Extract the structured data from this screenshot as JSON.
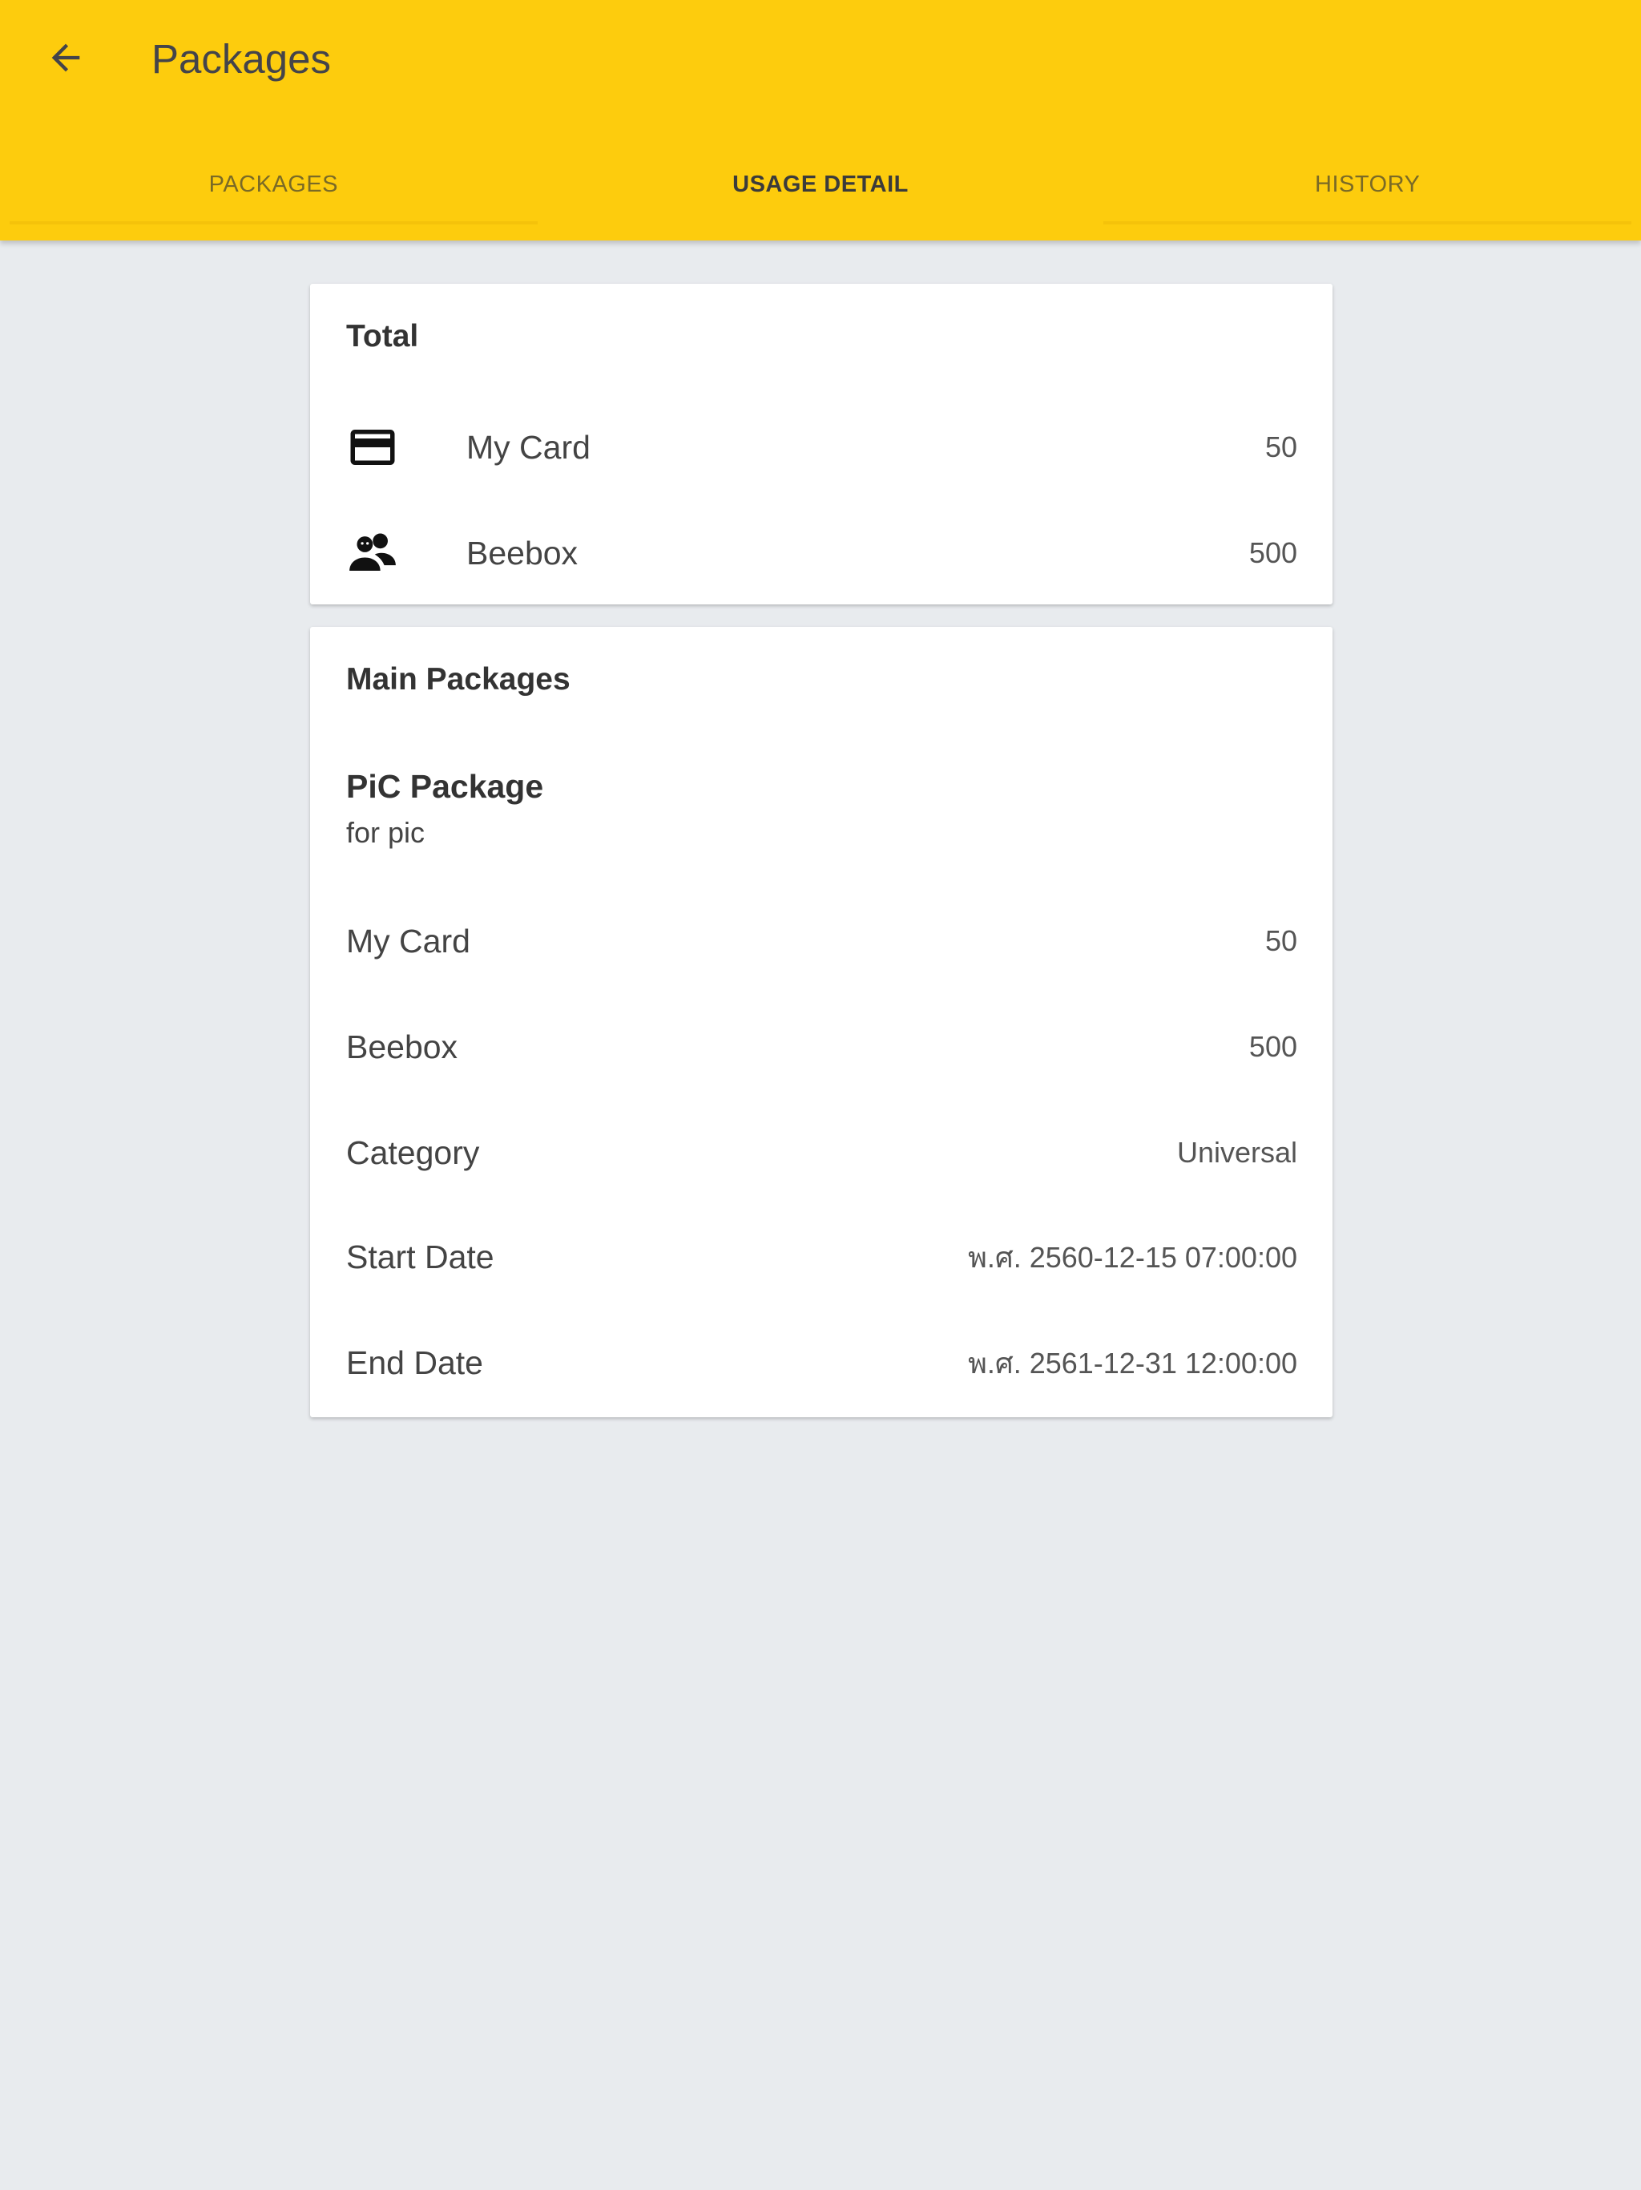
{
  "appbar": {
    "title": "Packages",
    "back_icon": "arrow-back-icon",
    "color": "#fdcc0d"
  },
  "tabs": [
    {
      "label": "PACKAGES",
      "active": false
    },
    {
      "label": "USAGE DETAIL",
      "active": true
    },
    {
      "label": "HISTORY",
      "active": false
    }
  ],
  "total": {
    "title": "Total",
    "items": [
      {
        "icon": "credit-card-icon",
        "label": "My Card",
        "value": "50"
      },
      {
        "icon": "people-icon",
        "label": "Beebox",
        "value": "500"
      }
    ]
  },
  "main_packages": {
    "title": "Main Packages",
    "package_name": "PiC Package",
    "package_desc": "for pic",
    "details": [
      {
        "label": "My Card",
        "value": "50"
      },
      {
        "label": "Beebox",
        "value": "500"
      },
      {
        "label": "Category",
        "value": "Universal"
      },
      {
        "label": "Start Date",
        "value": "พ.ศ. 2560-12-15 07:00:00"
      },
      {
        "label": "End Date",
        "value": "พ.ศ. 2561-12-31 12:00:00"
      }
    ]
  }
}
